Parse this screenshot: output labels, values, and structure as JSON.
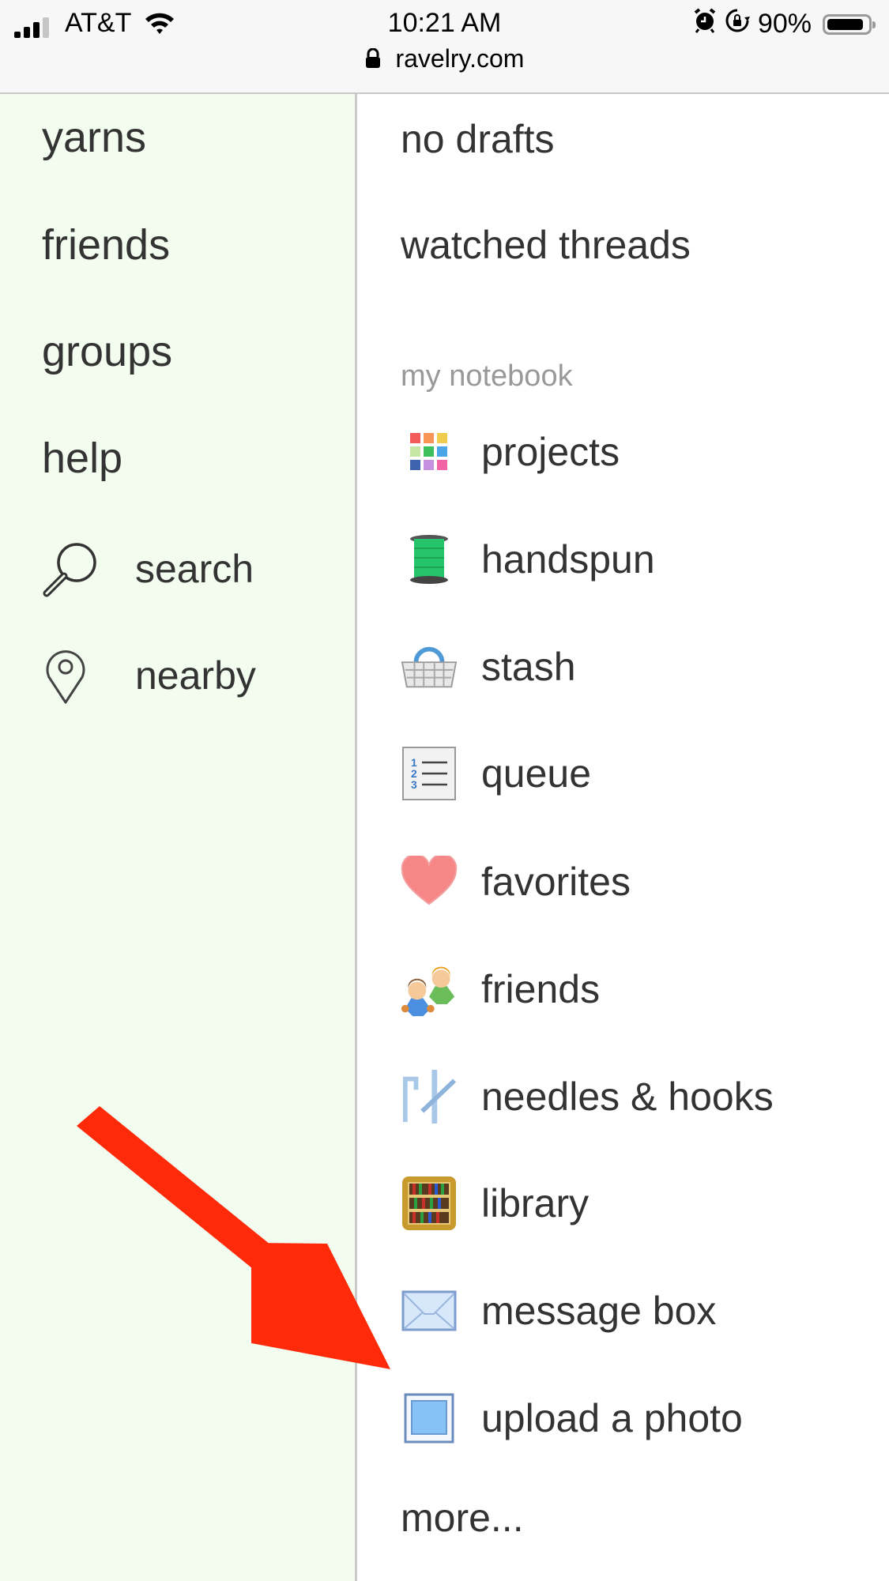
{
  "status_bar": {
    "carrier": "AT&T",
    "time": "10:21 AM",
    "battery_percent": "90%",
    "battery_level": 0.9,
    "signal_bars_active": 3,
    "signal_bars_total": 4,
    "icons": [
      "signal-icon",
      "wifi-icon",
      "alarm-icon",
      "rotation-lock-icon",
      "battery-icon"
    ]
  },
  "url_bar": {
    "domain": "ravelry.com",
    "icon": "lock-icon"
  },
  "sidebar": {
    "items": [
      {
        "label": "yarns"
      },
      {
        "label": "friends"
      },
      {
        "label": "groups"
      },
      {
        "label": "help"
      },
      {
        "label": "search",
        "icon": "magnifier-icon"
      },
      {
        "label": "nearby",
        "icon": "location-pin-icon"
      }
    ]
  },
  "main": {
    "links": [
      {
        "label": "no drafts"
      },
      {
        "label": "watched threads"
      }
    ],
    "section_label": "my notebook",
    "notebook": [
      {
        "label": "projects",
        "icon": "projects-grid-icon"
      },
      {
        "label": "handspun",
        "icon": "spool-icon"
      },
      {
        "label": "stash",
        "icon": "basket-icon"
      },
      {
        "label": "queue",
        "icon": "numbered-list-icon"
      },
      {
        "label": "favorites",
        "icon": "heart-icon"
      },
      {
        "label": "friends",
        "icon": "people-icon"
      },
      {
        "label": "needles & hooks",
        "icon": "needles-icon"
      },
      {
        "label": "library",
        "icon": "bookshelf-icon"
      },
      {
        "label": "message box",
        "icon": "envelope-icon"
      },
      {
        "label": "upload a photo",
        "icon": "photo-frame-icon"
      }
    ],
    "more_label": "more..."
  },
  "annotation": {
    "type": "arrow",
    "color": "#ff2a0a",
    "points_to": "upload a photo"
  },
  "colors": {
    "sidebar_bg": "#f2fcef",
    "text": "#333333",
    "section_label": "#999999",
    "arrow": "#ff2a0a"
  }
}
